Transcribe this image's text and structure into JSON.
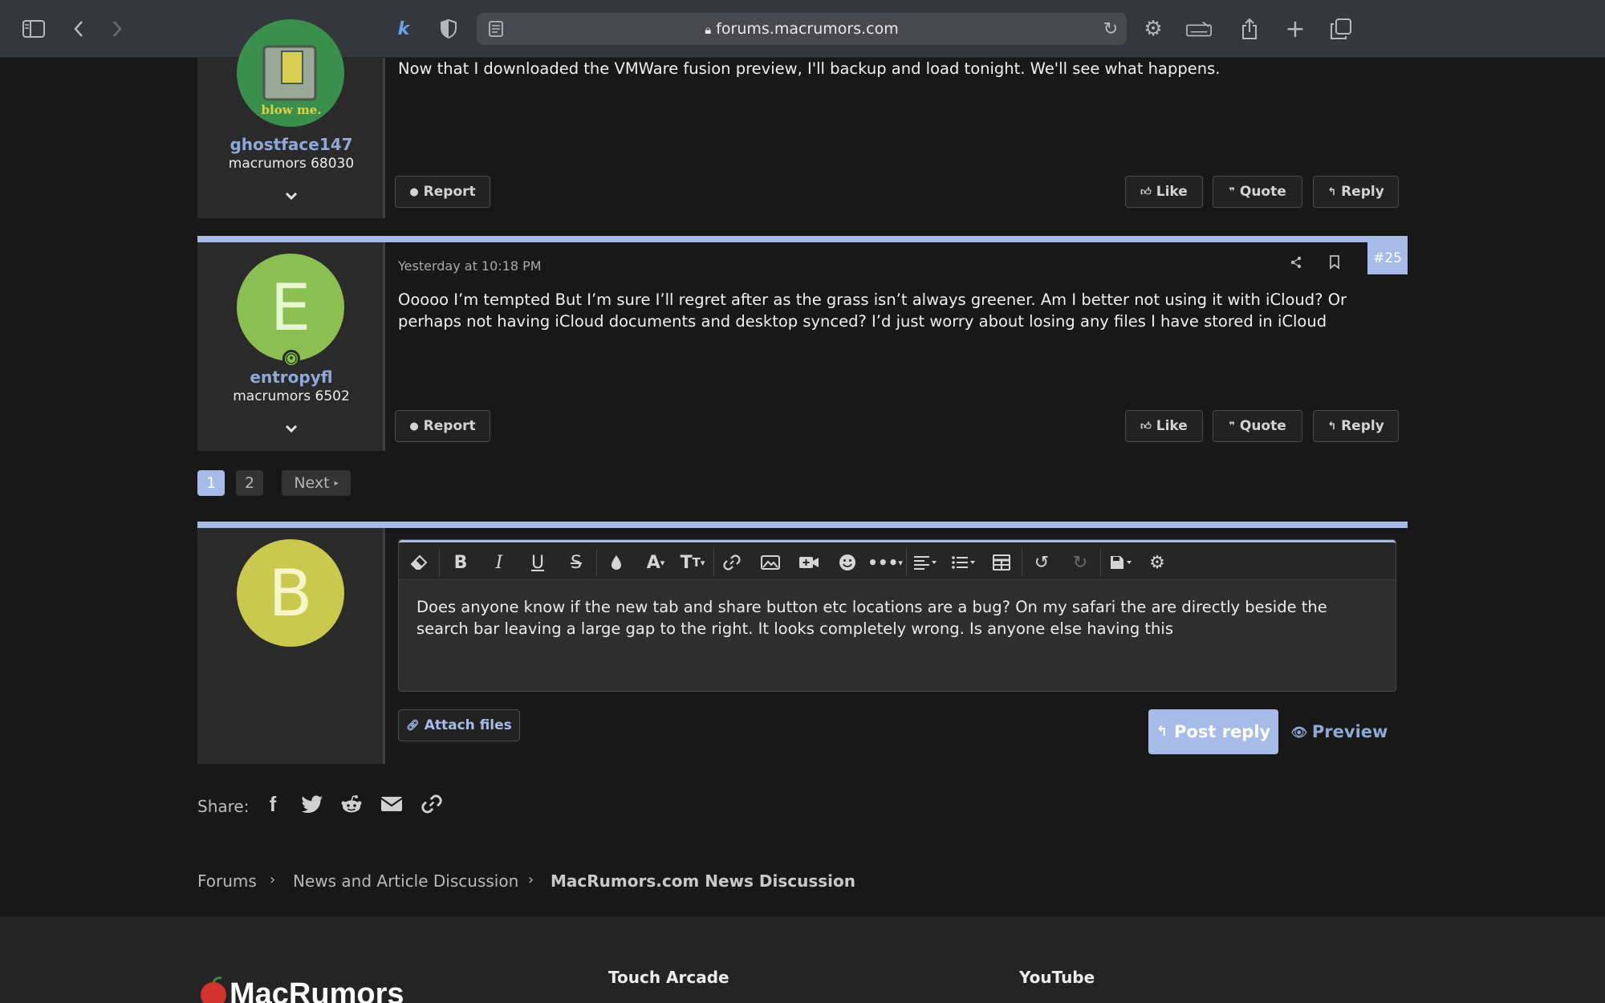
{
  "browser": {
    "url": "forums.macrumors.com",
    "icons": [
      "sidebar-icon",
      "back-icon",
      "forward-icon",
      "extension-icon",
      "shield-icon",
      "reader-icon",
      "lock-icon",
      "reload-icon",
      "gear-icon",
      "keyboard-icon",
      "share-icon",
      "new-tab-icon",
      "tabs-overview-icon"
    ]
  },
  "posts": [
    {
      "username": "ghostface147",
      "user_title": "macrumors 68030",
      "avatar_caption": "blow me.",
      "text": "Now that I downloaded the VMWare fusion preview, I'll backup and load tonight. We'll see what happens.",
      "report_label": "Report",
      "like_label": "Like",
      "quote_label": "Quote",
      "reply_label": "Reply"
    },
    {
      "username": "entropyfl",
      "user_title": "macrumors 6502",
      "avatar_letter": "E",
      "avatar_color": "#8cbf52",
      "timestamp": "Yesterday at 10:18 PM",
      "post_number": "#25",
      "text": "Ooooo I’m tempted But I’m sure I’ll regret after as the grass isn’t always greener. Am I better not using it with iCloud? Or perhaps not having iCloud documents and desktop synced? I’d just worry about losing any files I have stored in iCloud",
      "report_label": "Report",
      "like_label": "Like",
      "quote_label": "Quote",
      "reply_label": "Reply"
    }
  ],
  "pagination": {
    "pages": [
      "1",
      "2"
    ],
    "current": "1",
    "next_label": "Next"
  },
  "reply": {
    "avatar_letter": "B",
    "avatar_color": "#c9c94f",
    "draft_text": "Does anyone know if the new tab and share button etc locations are a bug? On my safari the are directly beside the search bar leaving a large gap to the right. It looks completely wrong. Is anyone else having this",
    "attach_label": "Attach files",
    "post_reply_label": "Post reply",
    "preview_label": "Preview"
  },
  "share": {
    "label": "Share:",
    "icons": [
      "facebook-icon",
      "twitter-icon",
      "reddit-icon",
      "email-icon",
      "link-icon"
    ]
  },
  "breadcrumb": [
    "Forums",
    "News and Article Discussion",
    "MacRumors.com News Discussion"
  ],
  "footer": {
    "logo_text": "MacRumors",
    "col1": "Touch Arcade",
    "col2": "YouTube"
  },
  "colors": {
    "accent": "#a6bbe8",
    "username": "#8fa8d6",
    "post_reply_button": "#a6bbe8"
  }
}
